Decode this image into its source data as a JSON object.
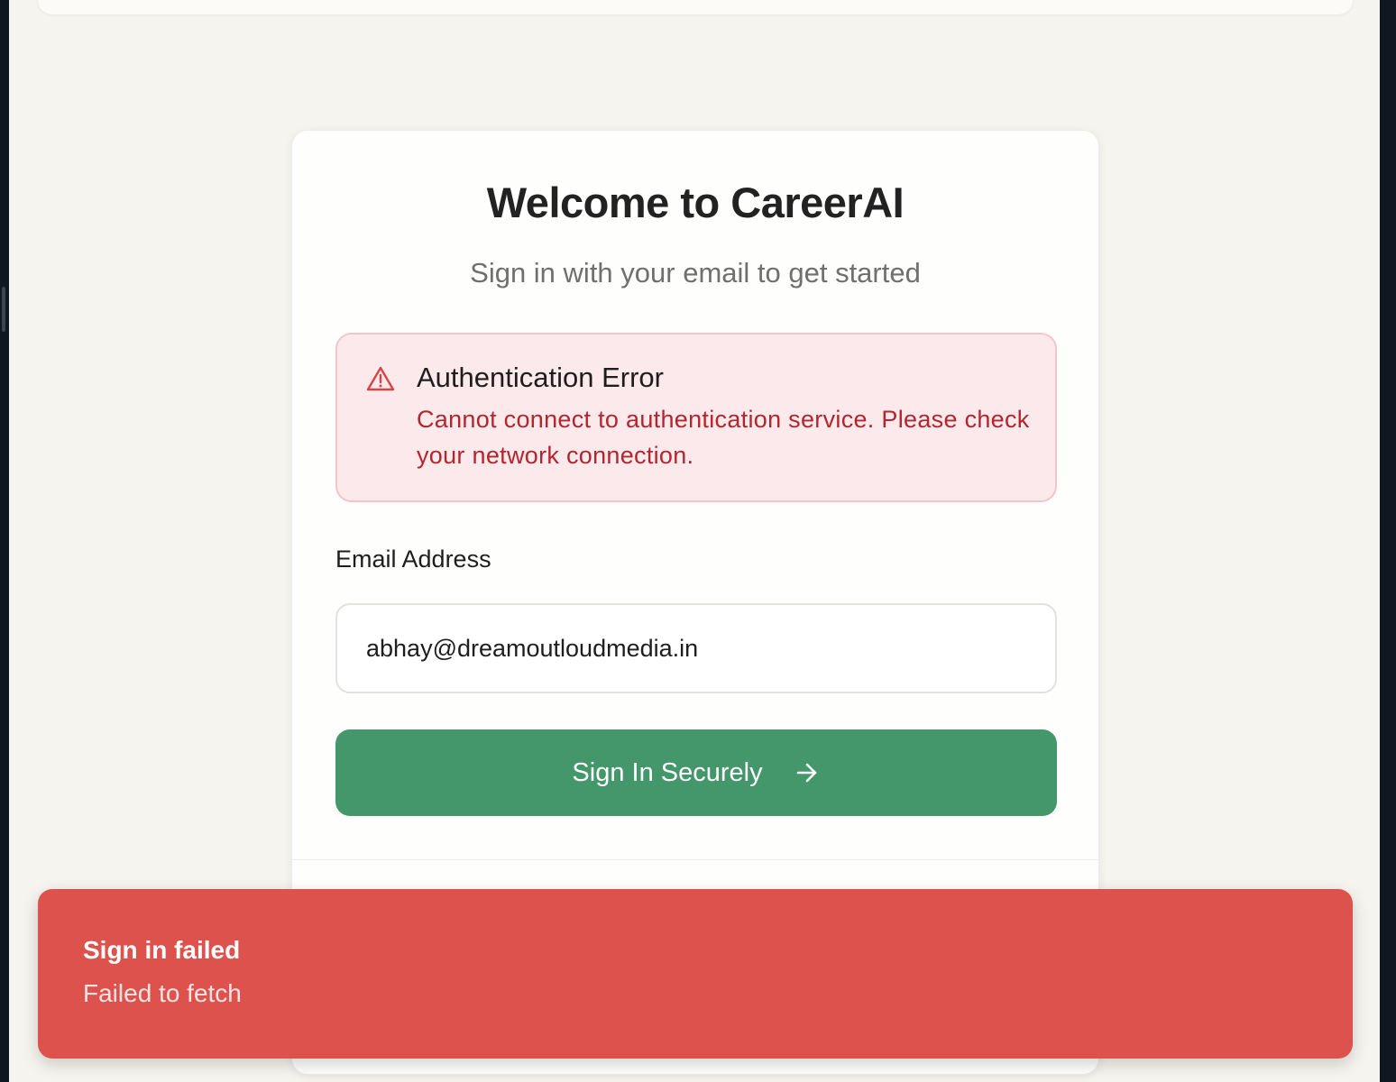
{
  "login": {
    "title": "Welcome to CareerAI",
    "subtitle": "Sign in with your email to get started",
    "error_alert": {
      "icon": "warning-triangle-icon",
      "title": "Authentication Error",
      "message": "Cannot connect to authentication service. Please check your network connection."
    },
    "email": {
      "label": "Email Address",
      "value": "abhay@dreamoutloudmedia.in"
    },
    "submit": {
      "label": "Sign In Securely",
      "icon": "arrow-right-icon"
    }
  },
  "toast": {
    "title": "Sign in failed",
    "message": "Failed to fetch"
  },
  "colors": {
    "page_background": "#f6f4ef",
    "primary_button": "#43976a",
    "error_text": "#b3262e",
    "error_background": "#fce9ec",
    "toast_background": "#de524e"
  }
}
